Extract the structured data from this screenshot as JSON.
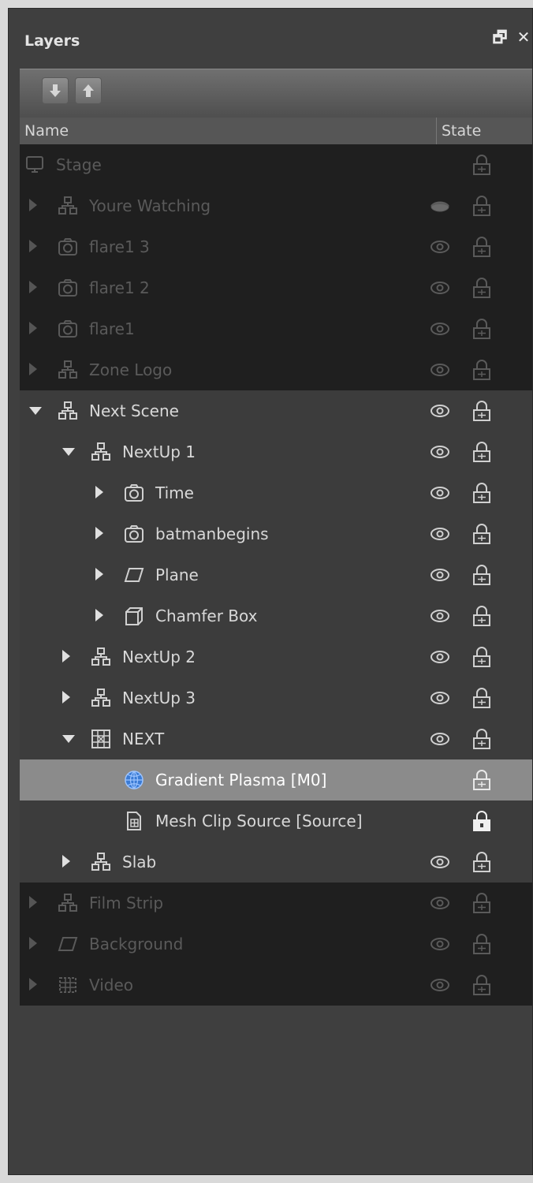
{
  "panel": {
    "title": "Layers"
  },
  "title_buttons": {
    "float": "🗗",
    "close": "✕"
  },
  "toolbar": {
    "move_down": "move-down",
    "move_up": "move-up"
  },
  "columns": {
    "name": "Name",
    "state": "State"
  },
  "rows": [
    {
      "label": "Stage",
      "style": "dim",
      "level": 0,
      "expander": "none",
      "icon": "monitor",
      "eye": "none",
      "lock": "unlocked"
    },
    {
      "label": "Youre Watching",
      "style": "dim",
      "level": 1,
      "expander": "right",
      "icon": "group",
      "eye": "hidden",
      "lock": "unlocked"
    },
    {
      "label": "flare1 3",
      "style": "dim",
      "level": 1,
      "expander": "right",
      "icon": "camera",
      "eye": "visible",
      "lock": "unlocked"
    },
    {
      "label": "flare1 2",
      "style": "dim",
      "level": 1,
      "expander": "right",
      "icon": "camera",
      "eye": "visible",
      "lock": "unlocked"
    },
    {
      "label": "flare1",
      "style": "dim",
      "level": 1,
      "expander": "right",
      "icon": "camera",
      "eye": "visible",
      "lock": "unlocked"
    },
    {
      "label": "Zone Logo",
      "style": "dim",
      "level": 1,
      "expander": "right",
      "icon": "group",
      "eye": "visible",
      "lock": "unlocked"
    },
    {
      "label": "Next Scene",
      "style": "normal",
      "level": 1,
      "expander": "down",
      "icon": "group",
      "eye": "visible",
      "lock": "unlocked"
    },
    {
      "label": "NextUp 1",
      "style": "normal",
      "level": 2,
      "expander": "down",
      "icon": "group",
      "eye": "visible",
      "lock": "unlocked"
    },
    {
      "label": "Time",
      "style": "normal",
      "level": 3,
      "expander": "right",
      "icon": "camera",
      "eye": "visible",
      "lock": "unlocked"
    },
    {
      "label": "batmanbegins",
      "style": "normal",
      "level": 3,
      "expander": "right",
      "icon": "camera",
      "eye": "visible",
      "lock": "unlocked"
    },
    {
      "label": "Plane",
      "style": "normal",
      "level": 3,
      "expander": "right",
      "icon": "plane",
      "eye": "visible",
      "lock": "unlocked"
    },
    {
      "label": "Chamfer Box",
      "style": "normal",
      "level": 3,
      "expander": "right",
      "icon": "box",
      "eye": "visible",
      "lock": "unlocked"
    },
    {
      "label": "NextUp 2",
      "style": "normal",
      "level": 2,
      "expander": "right",
      "icon": "group",
      "eye": "visible",
      "lock": "unlocked"
    },
    {
      "label": "NextUp 3",
      "style": "normal",
      "level": 2,
      "expander": "right",
      "icon": "group",
      "eye": "visible",
      "lock": "unlocked"
    },
    {
      "label": "NEXT",
      "style": "normal",
      "level": 2,
      "expander": "down",
      "icon": "mesh",
      "eye": "visible",
      "lock": "unlocked"
    },
    {
      "label": "Gradient Plasma   [M0]",
      "style": "selected",
      "level": 3,
      "expander": "none",
      "icon": "globe",
      "eye": "none",
      "lock": "unlocked"
    },
    {
      "label": "Mesh Clip Source   [Source]",
      "style": "normal",
      "level": 3,
      "expander": "none",
      "icon": "document",
      "eye": "none",
      "lock": "locked"
    },
    {
      "label": "Slab",
      "style": "normal",
      "level": 2,
      "expander": "right",
      "icon": "group",
      "eye": "visible",
      "lock": "unlocked"
    },
    {
      "label": "Film Strip",
      "style": "dim",
      "level": 1,
      "expander": "right",
      "icon": "group",
      "eye": "visible",
      "lock": "unlocked"
    },
    {
      "label": "Background",
      "style": "dim",
      "level": 1,
      "expander": "right",
      "icon": "plane",
      "eye": "visible",
      "lock": "unlocked"
    },
    {
      "label": "Video",
      "style": "dim",
      "level": 1,
      "expander": "right",
      "icon": "video",
      "eye": "visible",
      "lock": "unlocked"
    }
  ]
}
